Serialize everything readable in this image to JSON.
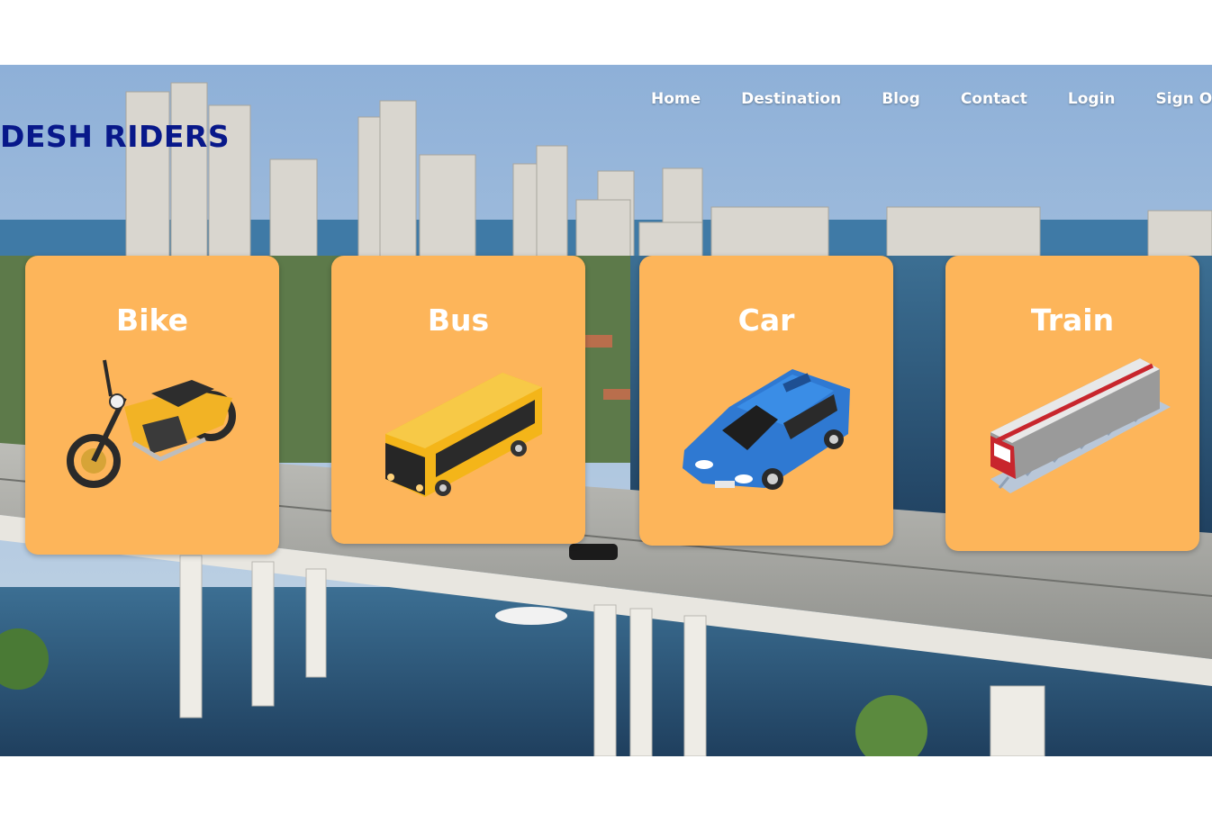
{
  "brand": {
    "name": "DESH RIDERS",
    "color": "#08188a"
  },
  "nav": {
    "items": [
      {
        "label": "Home",
        "icon": ""
      },
      {
        "label": "Destination"
      },
      {
        "label": "Blog"
      },
      {
        "label": "Contact"
      },
      {
        "label": "Login"
      },
      {
        "label": "Sign Out"
      }
    ]
  },
  "hero": {
    "background": "city-skyline-bridge-photo"
  },
  "vehicles": [
    {
      "title": "Bike",
      "icon": "motorbike-icon"
    },
    {
      "title": "Bus",
      "icon": "bus-icon"
    },
    {
      "title": "Car",
      "icon": "car-icon"
    },
    {
      "title": "Train",
      "icon": "train-icon"
    }
  ],
  "colors": {
    "card": "#fdb55a",
    "card_text": "#ffffff",
    "nav_text": "#ffffff"
  }
}
